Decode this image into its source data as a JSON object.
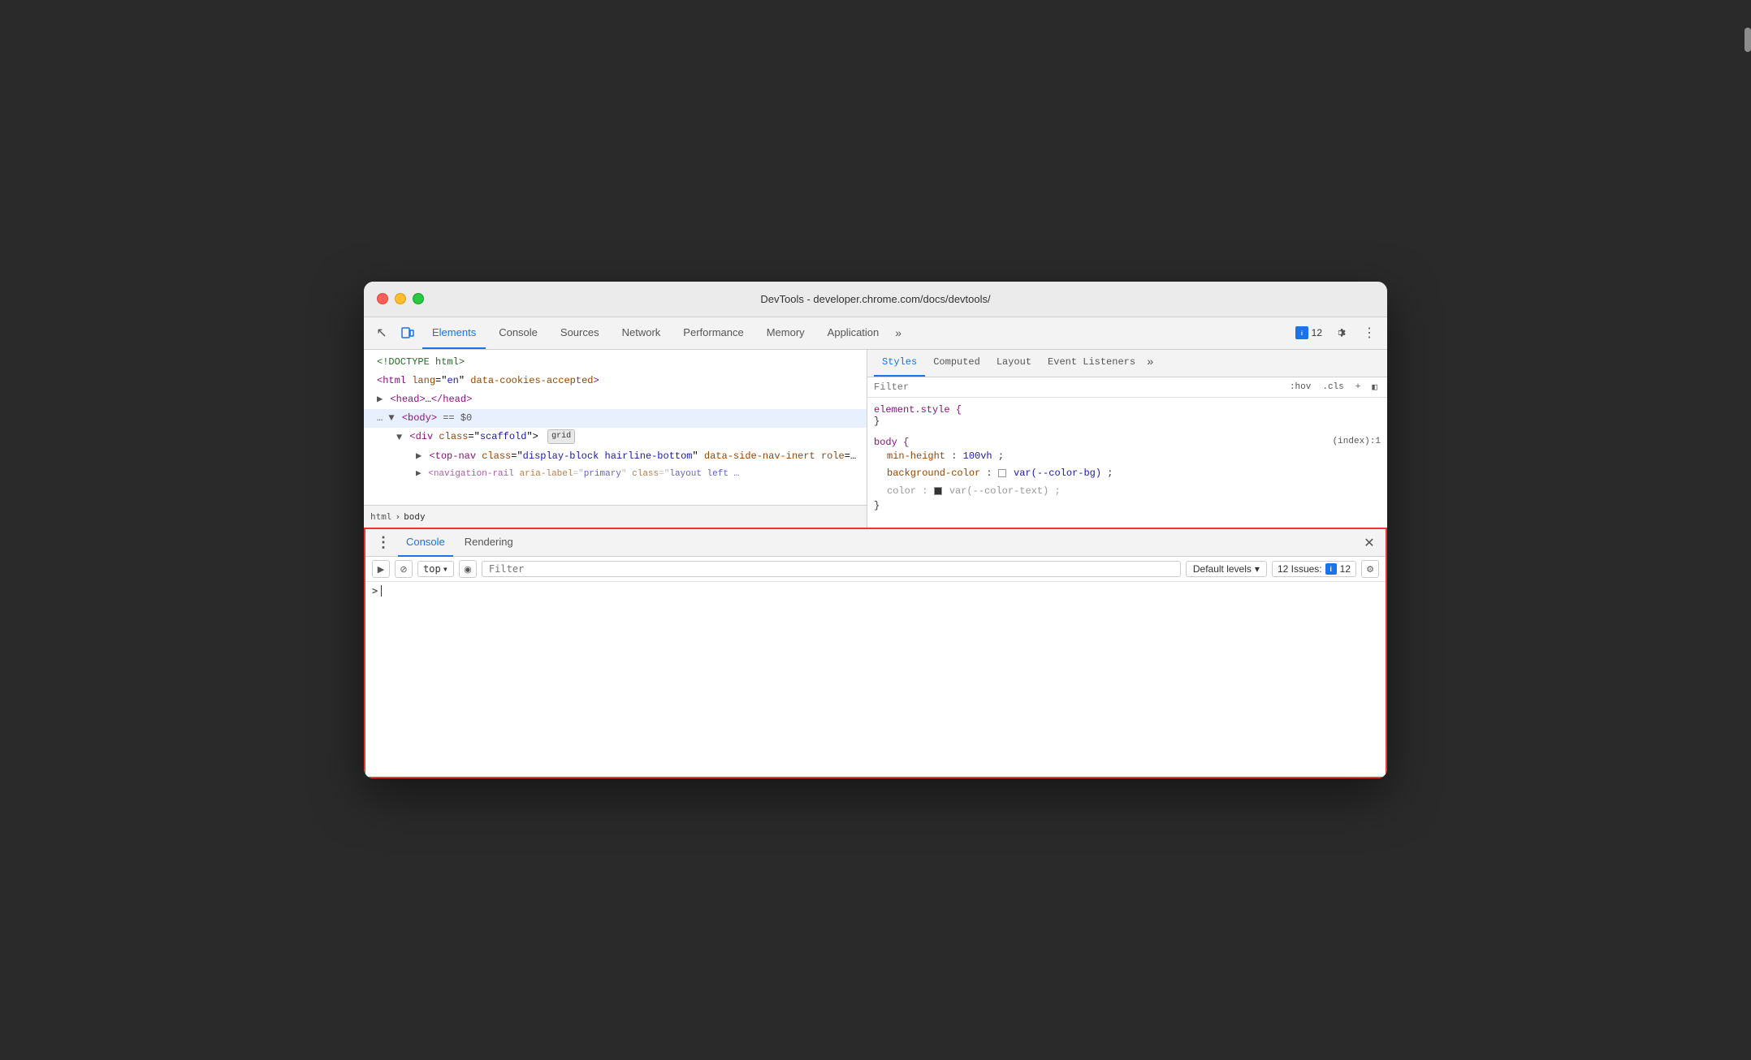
{
  "window": {
    "title": "DevTools - developer.chrome.com/docs/devtools/"
  },
  "toolbar": {
    "tabs": [
      "Elements",
      "Console",
      "Sources",
      "Network",
      "Performance",
      "Memory",
      "Application"
    ],
    "active_tab": "Elements",
    "more_btn": "»",
    "issues_label": "12 Issues:",
    "issues_count": "12",
    "settings_icon": "⚙",
    "more_icon": "⋮"
  },
  "dom": {
    "lines": [
      "<!DOCTYPE html>",
      "<html lang=\"en\" data-cookies-accepted>",
      "▶ <head>…</head>",
      "▼ <body> == $0",
      "  ▼ <div class=\"scaffold\">",
      "    ▶ <top-nav class=\"display-block hairline-bottom\" data-side-nav-inert role=\"banner\">…</top-nav>",
      "    ▶ <navigation-rail aria-label=\"primary\" class=\"layout left …"
    ],
    "breadcrumb": [
      "html",
      "body"
    ]
  },
  "styles": {
    "tabs": [
      "Styles",
      "Computed",
      "Layout",
      "Event Listeners"
    ],
    "active_tab": "Styles",
    "filter_placeholder": "Filter",
    "filter_hov": ":hov",
    "filter_cls": ".cls",
    "rules": [
      {
        "selector": "element.style {",
        "closing": "}",
        "source": "",
        "props": []
      },
      {
        "selector": "body {",
        "closing": "}",
        "source": "(index):1",
        "props": [
          {
            "name": "min-height",
            "colon": ":",
            "value": "100vh",
            "semi": ";",
            "has_swatch": false
          },
          {
            "name": "background-color",
            "colon": ":",
            "value": "var(--color-bg)",
            "semi": ";",
            "has_swatch": true,
            "swatch_color": "#fff"
          },
          {
            "name": "color",
            "colon": ":",
            "value": "var(--color-text)",
            "semi": ";",
            "has_swatch": true,
            "swatch_color": "#333",
            "faded": true
          }
        ]
      }
    ]
  },
  "console_drawer": {
    "tabs": [
      "Console",
      "Rendering"
    ],
    "active_tab": "Console",
    "top_label": "top",
    "filter_placeholder": "Filter",
    "default_levels": "Default levels",
    "issues_label": "12 Issues:",
    "issues_count": "12",
    "close_icon": "✕",
    "more_icon": "⋮"
  },
  "icons": {
    "cursor": "↖",
    "inspector": "□",
    "play": "▶",
    "ban": "⊘",
    "eye": "◉",
    "chevron_down": "▾",
    "gear": "⚙",
    "more": "⋮",
    "issues_icon": "■"
  }
}
